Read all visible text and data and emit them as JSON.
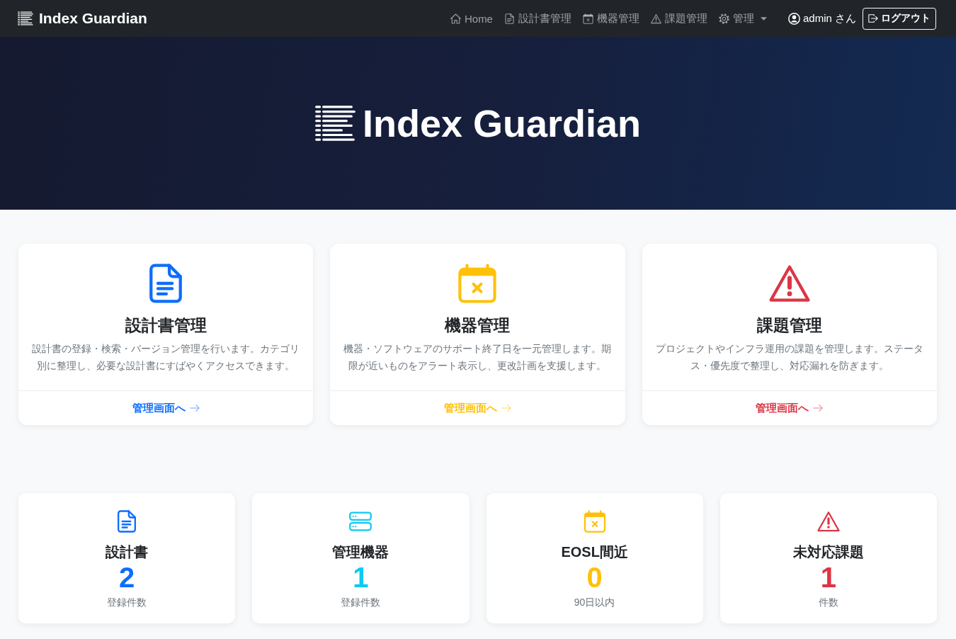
{
  "navbar": {
    "brand": "Index Guardian",
    "links": [
      {
        "kind": "home",
        "label": "Home",
        "selected": false,
        "dropdown": false
      },
      {
        "kind": "documents",
        "label": "設計書管理",
        "selected": false,
        "dropdown": false
      },
      {
        "kind": "devices",
        "label": "機器管理",
        "selected": false,
        "dropdown": false
      },
      {
        "kind": "issues",
        "label": "課題管理",
        "selected": false,
        "dropdown": false
      },
      {
        "kind": "admin",
        "label": "管理",
        "selected": false,
        "dropdown": true
      }
    ],
    "user": "admin さん",
    "logout": "ログアウト"
  },
  "hero": {
    "title": "Index Guardian"
  },
  "features": [
    {
      "kind": "documents",
      "title": "設計書管理",
      "description": "設計書の登録・検索・バージョン管理を行います。カテゴリ別に整理し、必要な設計書にすばやくアクセスできます。",
      "link": "管理画面へ",
      "color": "#0d6efd"
    },
    {
      "kind": "devices",
      "title": "機器管理",
      "description": "機器・ソフトウェアのサポート終了日を一元管理します。期限が近いものをアラート表示し、更改計画を支援します。",
      "link": "管理画面へ",
      "color": "#ffc107"
    },
    {
      "kind": "issues",
      "title": "課題管理",
      "description": "プロジェクトやインフラ運用の課題を管理します。ステータス・優先度で整理し、対応漏れを防ぎます。",
      "link": "管理画面へ",
      "color": "#dc3545"
    }
  ],
  "stats": [
    {
      "kind": "documents",
      "title": "設計書",
      "value": "2",
      "caption": "登録件数",
      "color": "#0d6efd"
    },
    {
      "kind": "devices",
      "title": "管理機器",
      "value": "1",
      "caption": "登録件数",
      "color": "#0dcaf0"
    },
    {
      "kind": "eosl",
      "title": "EOSL間近",
      "value": "0",
      "caption": "90日以内",
      "color": "#ffc107"
    },
    {
      "kind": "issues",
      "title": "未対応課題",
      "value": "1",
      "caption": "件数",
      "color": "#dc3545"
    }
  ]
}
